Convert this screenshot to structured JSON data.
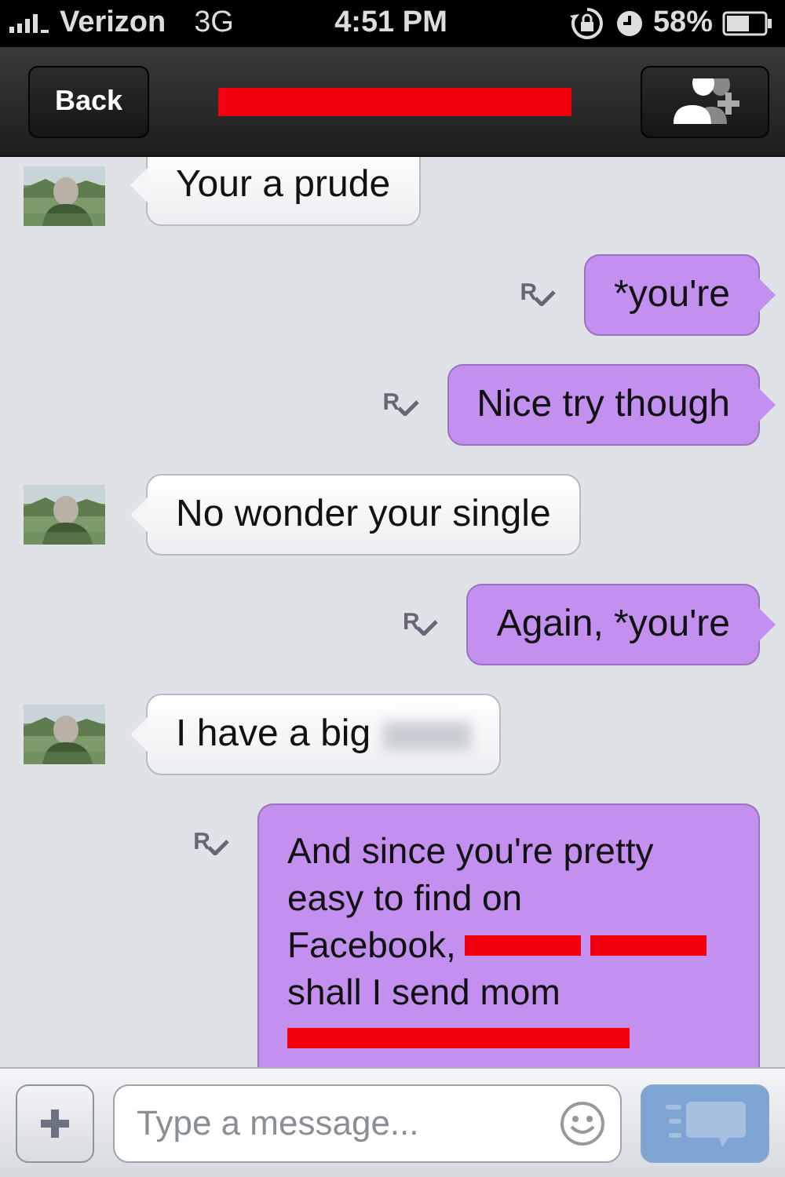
{
  "status_bar": {
    "carrier": "Verizon",
    "network": "3G",
    "time": "4:51 PM",
    "battery": "58%"
  },
  "nav": {
    "back": "Back",
    "title_redacted": true
  },
  "messages": [
    {
      "kind": "incoming",
      "text": "Your a prude"
    },
    {
      "kind": "outgoing",
      "text": "*you're",
      "receipt": "R"
    },
    {
      "kind": "outgoing",
      "text": "Nice try though",
      "receipt": "R"
    },
    {
      "kind": "incoming",
      "text": "No wonder your single"
    },
    {
      "kind": "outgoing",
      "text": "Again, *you're",
      "receipt": "R"
    },
    {
      "kind": "incoming",
      "text": "I have a big",
      "blurred": true
    },
    {
      "kind": "outgoing",
      "receipt": "R",
      "parts": [
        {
          "kind": "text",
          "text": "And since you're pretty easy to find on"
        },
        {
          "kind": "text",
          "text": "Facebook,"
        },
        {
          "kind": "redaction"
        },
        {
          "kind": "redaction"
        },
        {
          "kind": "text",
          "text": "shall I send mom"
        },
        {
          "kind": "redaction"
        }
      ]
    }
  ],
  "composer": {
    "placeholder": "Type a message..."
  }
}
